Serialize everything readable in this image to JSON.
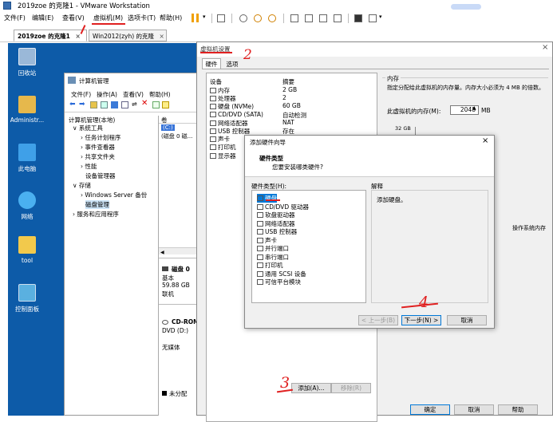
{
  "window": {
    "title": "2019zoe 的克隆1 - VMware Workstation"
  },
  "menu": [
    "文件(F)",
    "编辑(E)",
    "查看(V)",
    "虚拟机(M)",
    "选项卡(T)",
    "帮助(H)"
  ],
  "tabs": [
    {
      "label": "2019zoe 的克隆1",
      "active": true
    },
    {
      "label": "Win2012(zyh) 的克隆",
      "active": false
    }
  ],
  "desktop_icons": [
    {
      "label": "回收站",
      "icon": "recycle-bin-icon"
    },
    {
      "label": "Administr...",
      "icon": "user-folder-icon"
    },
    {
      "label": "此电脑",
      "icon": "computer-icon"
    },
    {
      "label": "网络",
      "icon": "network-icon"
    },
    {
      "label": "tool",
      "icon": "folder-icon"
    },
    {
      "label": "控制面板",
      "icon": "control-panel-icon"
    }
  ],
  "computer_management": {
    "title": "计算机管理",
    "menu": [
      "文件(F)",
      "操作(A)",
      "查看(V)",
      "帮助(H)"
    ],
    "tree": [
      "计算机管理(本地)",
      "系统工具",
      "任务计划程序",
      "事件查看器",
      "共享文件夹",
      "性能",
      "设备管理器",
      "存储",
      "Windows Server 备份",
      "磁盘管理",
      "服务和应用程序"
    ],
    "col_header": "卷",
    "volumes": [
      "(C:)",
      "(磁盘 0 磁..."
    ],
    "disk0": {
      "title": "磁盘 0",
      "type": "基本",
      "size": "59.88 GB",
      "status": "联机"
    },
    "cdrom": {
      "title": "CD-ROM",
      "drive": "DVD (D:)",
      "media": "无媒体"
    },
    "legend": "未分配"
  },
  "settings_dialog": {
    "title": "虚拟机设置",
    "tabs": [
      "硬件",
      "选项"
    ],
    "columns": [
      "设备",
      "摘要"
    ],
    "devices": [
      {
        "name": "内存",
        "summary": "2 GB"
      },
      {
        "name": "处理器",
        "summary": "2"
      },
      {
        "name": "硬盘 (NVMe)",
        "summary": "60 GB"
      },
      {
        "name": "CD/DVD (SATA)",
        "summary": "自动检测"
      },
      {
        "name": "网络适配器",
        "summary": "NAT"
      },
      {
        "name": "USB 控制器",
        "summary": "存在"
      },
      {
        "name": "声卡",
        "summary": ""
      },
      {
        "name": "打印机",
        "summary": ""
      },
      {
        "name": "显示器",
        "summary": ""
      }
    ],
    "memory_group": "内存",
    "memory_desc": "指定分配给此虚拟机的内存量。内存大小必须为 4 MB 的倍数。",
    "memory_label": "此虚拟机的内存(M):",
    "memory_value": "2048",
    "memory_unit": "MB",
    "scale_top": "32 GB",
    "recommend_text": "操作系统内存",
    "add_button": "添加(A)...",
    "remove_button": "移除(R)",
    "ok": "确定",
    "cancel": "取消",
    "help": "帮助"
  },
  "wizard": {
    "title": "添加硬件向导",
    "heading": "硬件类型",
    "subheading": "您要安装哪类硬件?",
    "list_label": "硬件类型(H):",
    "explain_label": "解释",
    "explain_text": "添加硬盘。",
    "items": [
      "硬盘",
      "CD/DVD 驱动器",
      "软盘驱动器",
      "网络适配器",
      "USB 控制器",
      "声卡",
      "并行端口",
      "串行端口",
      "打印机",
      "通用 SCSI 设备",
      "可信平台模块"
    ],
    "selected_index": 0,
    "back": "< 上一步(B)",
    "next": "下一步(N) >",
    "cancel": "取消"
  },
  "annotations": [
    "2",
    "3",
    "4"
  ]
}
